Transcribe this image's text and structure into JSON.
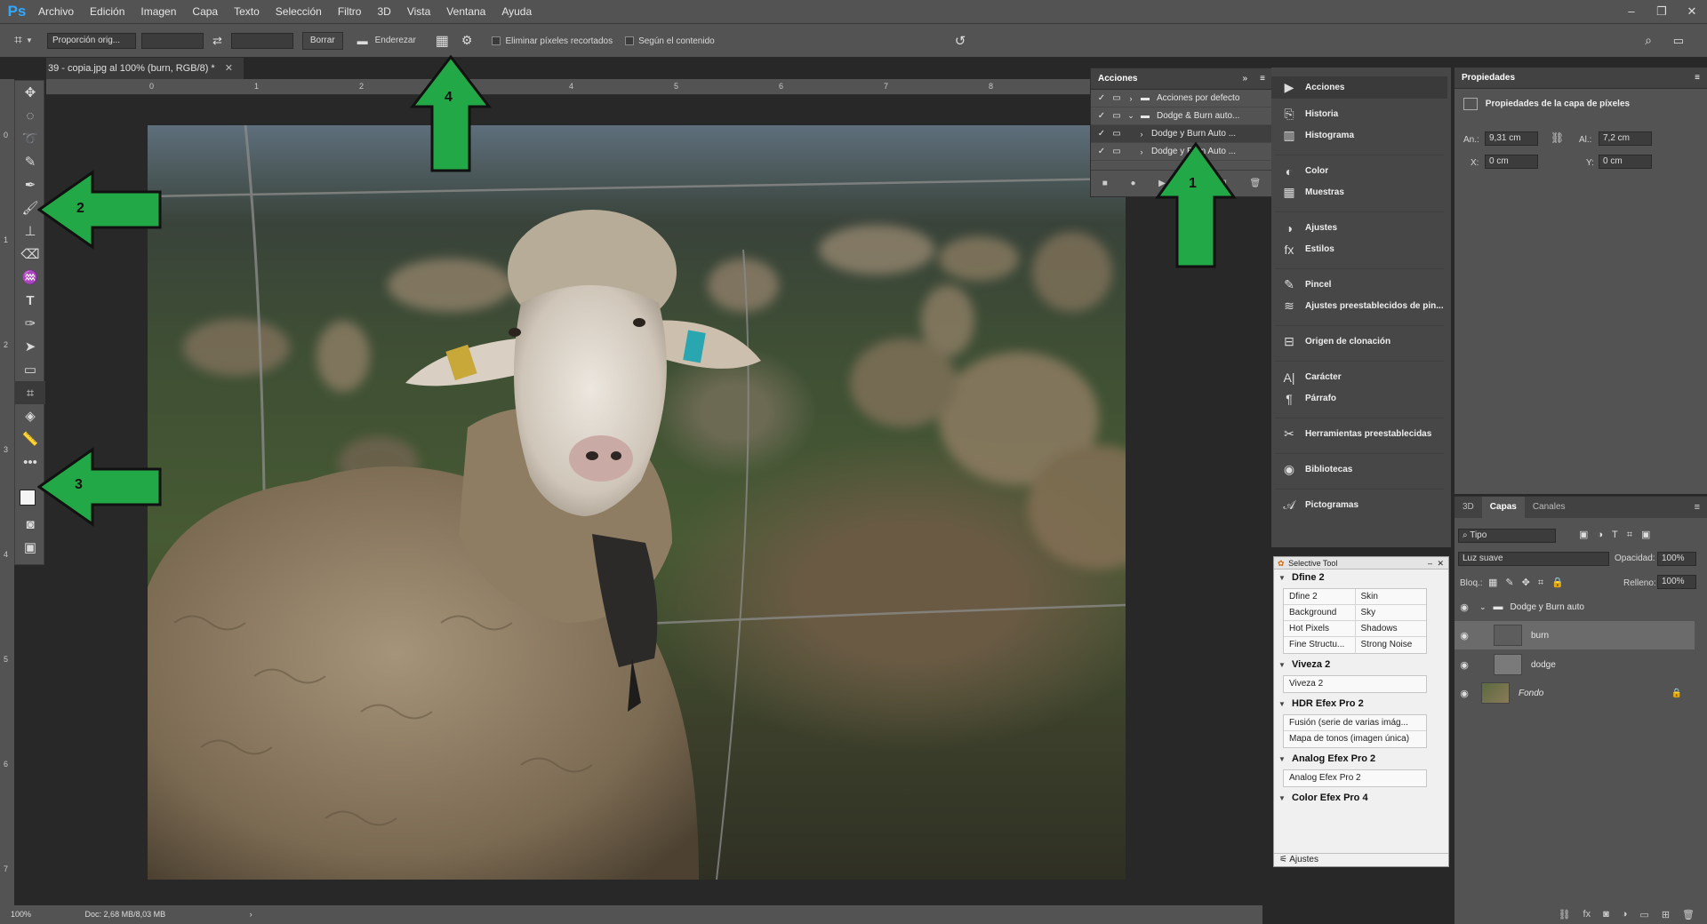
{
  "app": {
    "logo": "Ps"
  },
  "menu": [
    "Archivo",
    "Edición",
    "Imagen",
    "Capa",
    "Texto",
    "Selección",
    "Filtro",
    "3D",
    "Vista",
    "Ventana",
    "Ayuda"
  ],
  "options_bar": {
    "ratio": "Proporción orig...",
    "clear": "Borrar",
    "straighten": "Enderezar",
    "delete_cropped": "Eliminar píxeles recortados",
    "content_aware": "Según el contenido"
  },
  "document": {
    "tab_title": "39 - copia.jpg al 100% (burn, RGB/8) *",
    "zoom": "100%",
    "doc_size": "Doc: 2,68 MB/8,03 MB",
    "ruler_top": [
      "0",
      "1",
      "2",
      "3",
      "4",
      "5",
      "6",
      "7",
      "8",
      "9"
    ],
    "ruler_left": [
      "0",
      "1",
      "2",
      "3",
      "4",
      "5",
      "6",
      "7"
    ]
  },
  "actions_panel": {
    "title": "Acciones",
    "items": [
      {
        "label": "Acciones por defecto"
      },
      {
        "label": "Dodge & Burn auto..."
      },
      {
        "label": "Dodge y Burn Auto ..."
      },
      {
        "label": "Dodge y Burn Auto ..."
      }
    ]
  },
  "dock": {
    "items": [
      {
        "label": "Acciones",
        "icon": "play-icon"
      },
      {
        "label": "Historia",
        "icon": "history-icon"
      },
      {
        "label": "Histograma",
        "icon": "histogram-icon"
      },
      {
        "label": "Color",
        "icon": "color-icon"
      },
      {
        "label": "Muestras",
        "icon": "swatches-icon"
      },
      {
        "label": "Ajustes",
        "icon": "adjustments-icon"
      },
      {
        "label": "Estilos",
        "icon": "styles-icon"
      },
      {
        "label": "Pincel",
        "icon": "brush-icon"
      },
      {
        "label": "Ajustes preestablecidos de pin...",
        "icon": "brush-presets-icon"
      },
      {
        "label": "Origen de clonación",
        "icon": "clone-source-icon"
      },
      {
        "label": "Carácter",
        "icon": "character-icon"
      },
      {
        "label": "Párrafo",
        "icon": "paragraph-icon"
      },
      {
        "label": "Herramientas preestablecidas",
        "icon": "tool-presets-icon"
      },
      {
        "label": "Bibliotecas",
        "icon": "libraries-icon"
      },
      {
        "label": "Pictogramas",
        "icon": "glyphs-icon"
      }
    ]
  },
  "properties": {
    "title": "Propiedades",
    "subtitle": "Propiedades de la capa de píxeles",
    "w_label": "An.:",
    "w": "9,31 cm",
    "h_label": "Al.:",
    "h": "7,2 cm",
    "x_label": "X:",
    "x": "0 cm",
    "y_label": "Y:",
    "y": "0 cm"
  },
  "layers_panel": {
    "tabs": [
      "3D",
      "Capas",
      "Canales"
    ],
    "filter": "Tipo",
    "blend_mode": "Luz suave",
    "opacity_label": "Opacidad:",
    "opacity": "100%",
    "lock_label": "Bloq.:",
    "fill_label": "Relleno:",
    "fill": "100%",
    "layers": [
      {
        "name": "Dodge y Burn auto"
      },
      {
        "name": "burn"
      },
      {
        "name": "dodge"
      },
      {
        "name": "Fondo"
      }
    ]
  },
  "selective_tool": {
    "title": "Selective Tool",
    "footer": "Ajustes",
    "sections": [
      {
        "name": "Dfine 2",
        "rows": [
          [
            "Dfine 2",
            "Skin"
          ],
          [
            "Background",
            "Sky"
          ],
          [
            "Hot Pixels",
            "Shadows"
          ],
          [
            "Fine Structu...",
            "Strong Noise"
          ]
        ]
      },
      {
        "name": "Viveza 2",
        "rows": [
          [
            "Viveza 2"
          ]
        ]
      },
      {
        "name": "HDR Efex Pro 2",
        "rows": [
          [
            "Fusión (serie de varias imág..."
          ],
          [
            "Mapa de tonos (imagen única)"
          ]
        ]
      },
      {
        "name": "Analog Efex Pro 2",
        "rows": [
          [
            "Analog Efex Pro 2"
          ]
        ]
      },
      {
        "name": "Color Efex Pro 4",
        "rows": []
      }
    ]
  },
  "annotations": [
    "1",
    "2",
    "3",
    "4"
  ],
  "colors": {
    "arrow": "#22a846",
    "accent": "#31a8ff"
  }
}
